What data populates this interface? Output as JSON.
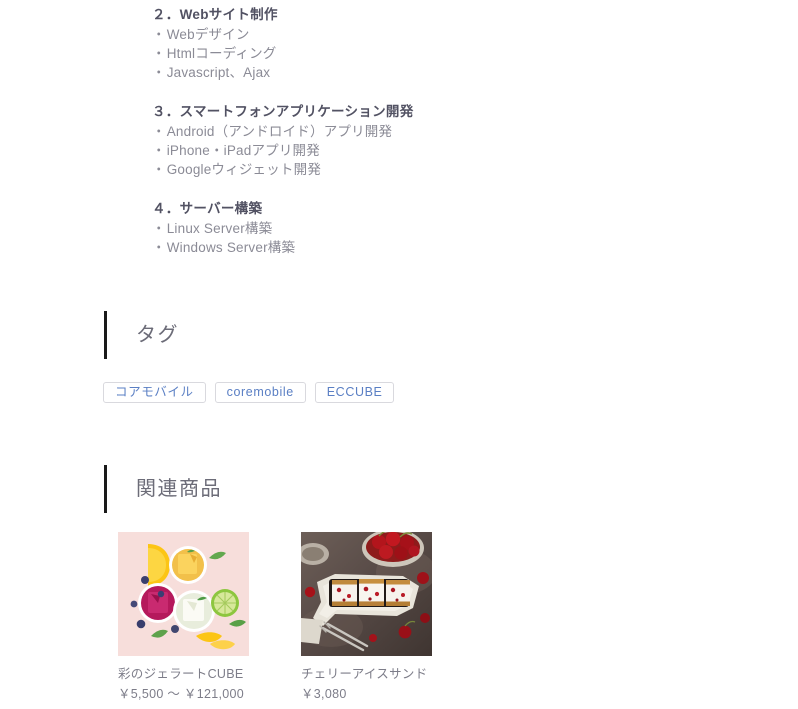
{
  "description": {
    "groups": [
      {
        "title": "２．Webサイト制作",
        "items": [
          "Webデザイン",
          "Htmlコーディング",
          "Javascript、Ajax"
        ]
      },
      {
        "title": "３．スマートフォンアプリケーション開発",
        "items": [
          "Android（アンドロイド）アプリ開発",
          "iPhone・iPadアプリ開発",
          "Googleウィジェット開発"
        ]
      },
      {
        "title": "４．サーバー構築",
        "items": [
          "Linux Server構築",
          "Windows Server構築"
        ]
      }
    ],
    "bullet": "・"
  },
  "tag_section": {
    "heading": "タグ",
    "tags": [
      {
        "label": "コアモバイル"
      },
      {
        "label": "coremobile"
      },
      {
        "label": "ECCUBE"
      }
    ]
  },
  "related_section": {
    "heading": "関連商品",
    "products": [
      {
        "name": "彩のジェラートCUBE",
        "price": "￥5,500 〜 ￥121,000",
        "image_name": "gelato-cube-photo"
      },
      {
        "name": "チェリーアイスサンド",
        "price": "￥3,080",
        "image_name": "cherry-ice-sandwich-photo"
      }
    ]
  },
  "colors": {
    "accent_bar": "#1a1a1a",
    "tag_text": "#5a7fc4",
    "tag_border": "#d9d9de",
    "heading_text": "#6c6c78",
    "body_text": "#8b8b96",
    "title_text": "#525263"
  }
}
